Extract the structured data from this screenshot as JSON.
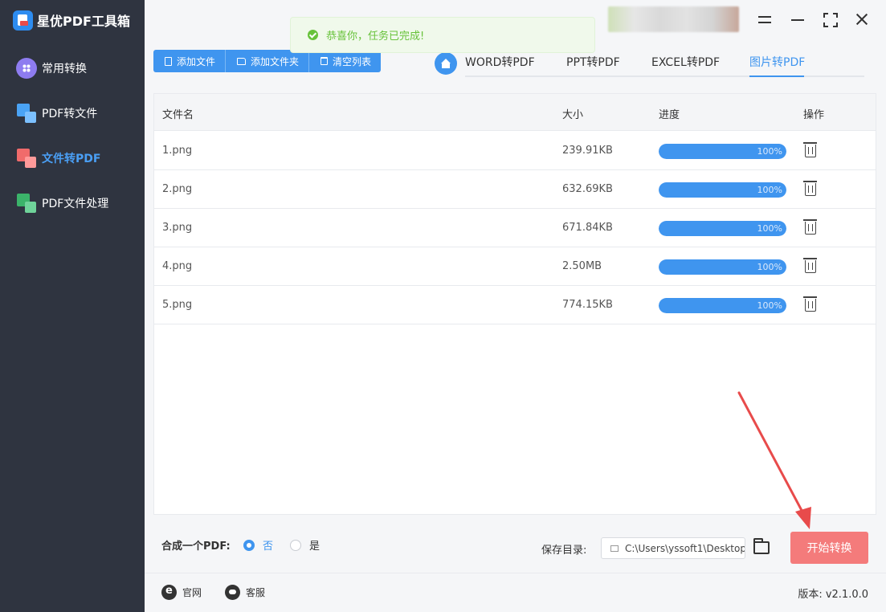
{
  "app": {
    "title": "星优PDF工具箱"
  },
  "sidebar": {
    "items": [
      {
        "label": "常用转换",
        "icon": "grid-icon"
      },
      {
        "label": "PDF转文件",
        "icon": "pdf-to-file-icon"
      },
      {
        "label": "文件转PDF",
        "icon": "file-to-pdf-icon",
        "active": true
      },
      {
        "label": "PDF文件处理",
        "icon": "pdf-process-icon"
      }
    ]
  },
  "toast": {
    "message": "恭喜你，任务已完成!",
    "color": "#67c23a"
  },
  "toolbar": {
    "add_file": "添加文件",
    "add_folder": "添加文件夹",
    "clear_list": "清空列表"
  },
  "tabs": [
    {
      "label": "WORD转PDF"
    },
    {
      "label": "PPT转PDF"
    },
    {
      "label": "EXCEL转PDF"
    },
    {
      "label": "图片转PDF",
      "active": true
    }
  ],
  "table": {
    "headers": {
      "name": "文件名",
      "size": "大小",
      "progress": "进度",
      "action": "操作"
    },
    "rows": [
      {
        "name": "1.png",
        "size": "239.91KB",
        "progress": 1.0,
        "progress_text": "100%"
      },
      {
        "name": "2.png",
        "size": "632.69KB",
        "progress": 1.0,
        "progress_text": "100%"
      },
      {
        "name": "3.png",
        "size": "671.84KB",
        "progress": 1.0,
        "progress_text": "100%"
      },
      {
        "name": "4.png",
        "size": "2.50MB",
        "progress": 1.0,
        "progress_text": "100%"
      },
      {
        "name": "5.png",
        "size": "774.15KB",
        "progress": 1.0,
        "progress_text": "100%"
      }
    ]
  },
  "bottom": {
    "merge_label": "合成一个PDF:",
    "option_no": "否",
    "option_yes": "是",
    "save_label": "保存目录:",
    "save_path": "C:\\Users\\yssoft1\\Desktop",
    "start_button": "开始转换"
  },
  "footer": {
    "website": "官网",
    "support": "客服",
    "version": "版本: v2.1.0.0"
  },
  "colors": {
    "accent": "#3f95ef",
    "sidebar": "#2f3440",
    "start_button": "#f47b7b",
    "arrow": "#e84b4b"
  }
}
